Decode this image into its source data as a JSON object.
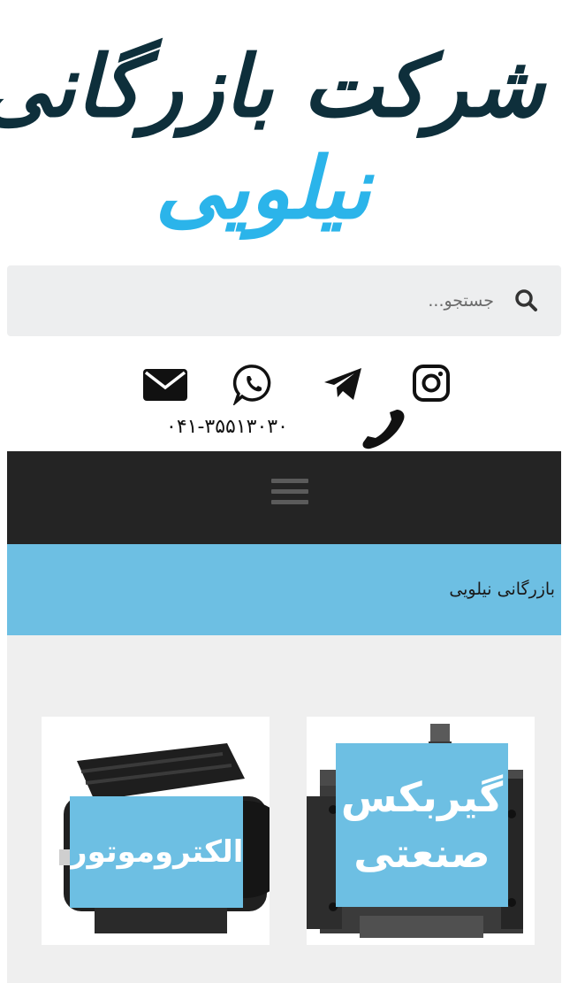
{
  "logo": {
    "company_text": "شرکت بازرگانی",
    "brand_text": "نیلویی",
    "colors": {
      "company": "#0e2f3b",
      "brand": "#2bb4ea"
    }
  },
  "search": {
    "placeholder": "جستجو...",
    "icon": "search-icon"
  },
  "social": {
    "icons": [
      "instagram-icon",
      "telegram-icon",
      "whatsapp-icon",
      "email-icon",
      "phone-icon"
    ],
    "phone": "۰۴۱-۳۵۵۱۳۰۳۰"
  },
  "nav": {
    "menu_icon": "hamburger-menu-icon",
    "background": "#242424"
  },
  "breadcrumb": {
    "text": "بازرگانی نیلویی",
    "background": "#6dbfe3"
  },
  "products": [
    {
      "label": "گیربکس صنعتی",
      "image": "gearbox-product-image"
    },
    {
      "label": "الکتروموتور",
      "image": "electromotor-product-image"
    }
  ]
}
